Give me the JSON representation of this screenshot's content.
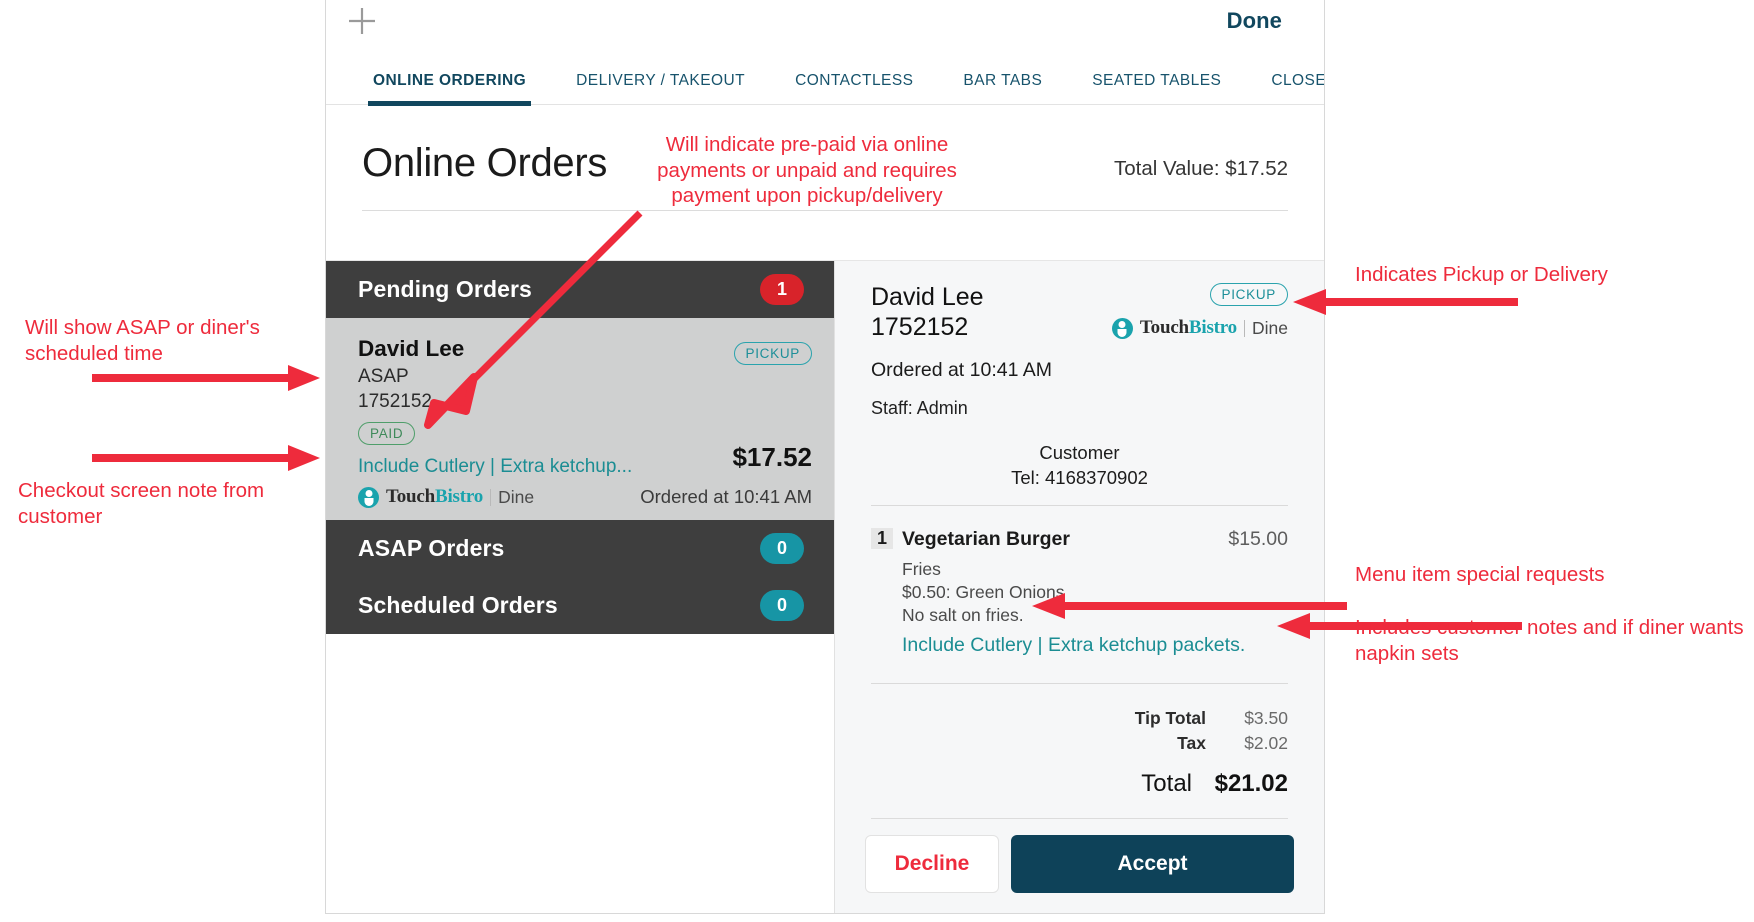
{
  "topbar": {
    "add_icon": "plus-icon",
    "done_label": "Done"
  },
  "tabs": [
    {
      "label": "ONLINE ORDERING",
      "active": true
    },
    {
      "label": "DELIVERY / TAKEOUT",
      "active": false
    },
    {
      "label": "CONTACTLESS",
      "active": false
    },
    {
      "label": "BAR TABS",
      "active": false
    },
    {
      "label": "SEATED TABLES",
      "active": false
    },
    {
      "label": "CLOSED",
      "active": false
    }
  ],
  "page": {
    "title": "Online Orders",
    "total_value": "Total Value: $17.52"
  },
  "groups": [
    {
      "label": "Pending Orders",
      "count": "1",
      "badge_color": "#d8232a"
    },
    {
      "label": "ASAP Orders",
      "count": "0",
      "badge_color": "#1795a5"
    },
    {
      "label": "Scheduled Orders",
      "count": "0",
      "badge_color": "#1795a5"
    }
  ],
  "order_card": {
    "name": "David Lee",
    "timing": "ASAP",
    "order_number": "1752152",
    "paid_badge": "PAID",
    "pickup_badge": "PICKUP",
    "note": "Include Cutlery | Extra ketchup...",
    "price": "$17.52",
    "ordered_at": "Ordered at 10:41 AM",
    "brand": "TouchBistro",
    "brand_prefix": "Touch",
    "brand_suffix": "Bistro",
    "brand_product": "Dine"
  },
  "detail": {
    "name": "David Lee",
    "order_number": "1752152",
    "ordered_at": "Ordered at 10:41 AM",
    "staff": "Staff: Admin",
    "pickup_badge": "PICKUP",
    "brand_prefix": "Touch",
    "brand_suffix": "Bistro",
    "brand_product": "Dine",
    "customer_label": "Customer",
    "customer_tel": "Tel: 4168370902",
    "items": [
      {
        "qty": "1",
        "name": "Vegetarian Burger",
        "price": "$15.00",
        "modifiers": [
          "Fries",
          "$0.50: Green Onions",
          "No salt on fries."
        ],
        "note": "Include Cutlery | Extra ketchup packets."
      }
    ],
    "totals": [
      {
        "label": "Tip Total",
        "value": "$3.50"
      },
      {
        "label": "Tax",
        "value": "$2.02"
      }
    ],
    "grand_total": {
      "label": "Total",
      "value": "$21.02"
    },
    "decline_label": "Decline",
    "accept_label": "Accept"
  },
  "annotations": {
    "paid_note": "Will indicate pre-paid via online payments or unpaid and requires payment upon pickup/delivery",
    "asap_note": "Will show ASAP or diner's scheduled time",
    "checkout_note": "Checkout screen note from customer",
    "pickup_delivery_note": "Indicates Pickup or Delivery",
    "special_requests_note": "Menu item special requests",
    "napkin_note": "Includes customer notes and if diner wants napkin sets"
  },
  "colors": {
    "brand_dark": "#0e4259",
    "teal": "#1aa3ad",
    "red": "#ee2b3c",
    "badge_red": "#d8232a",
    "annotation_red": "#ee2b3c"
  }
}
